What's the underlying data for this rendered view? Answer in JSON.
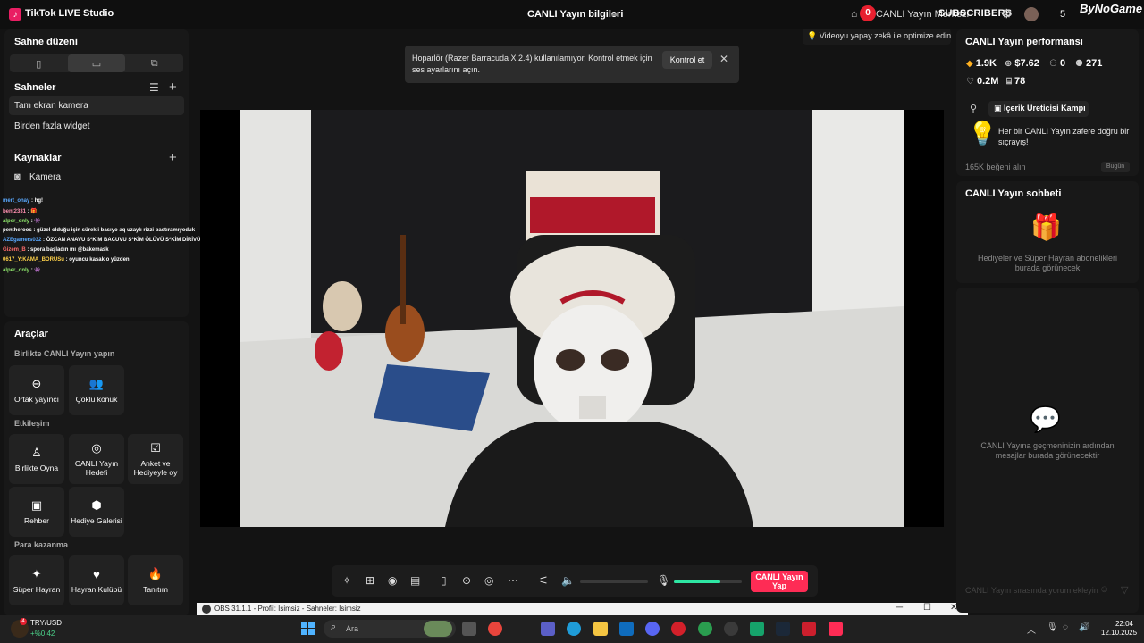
{
  "titlebar": {
    "app_title": "TikTok LIVE Studio",
    "center_title": "CANLI Yayın bilgileri",
    "notification_count": "0",
    "live_center_label": "CANLI Yayın Merkezi",
    "subscribers_label": "SUBSCRIBERS",
    "count_right": "5",
    "bynogame": "ByNoGame"
  },
  "left": {
    "layout_title": "Sahne düzeni",
    "scenes_title": "Sahneler",
    "scenes": [
      "Tam ekran kamera",
      "Birden fazla widget"
    ],
    "sources_title": "Kaynaklar",
    "sources": [
      "Kamera"
    ],
    "chat_overlay": [
      {
        "user": "mert_onay",
        "text": ": hg!",
        "color": "#5aa9ff"
      },
      {
        "user": "bent2331",
        "text": ": 🎁",
        "color": "#ff8fb0"
      },
      {
        "user": "alper_only",
        "text": ": 👾",
        "color": "#8de36a"
      },
      {
        "user": "pentheroos",
        "text": ": güzel olduğu için sürekli basıyo aq uzaylı rizzi bastıramıyoduk",
        "color": "#ffffff"
      },
      {
        "user": "AZEgamers032",
        "text": ": ÖZCAN ANAVU S*KİM BACUVU S*KİM ÖLÜVÜ S*KİM DİRİVÜ S*KİM",
        "color": "#5aa9ff"
      },
      {
        "user": "Gizem_B",
        "text": ": spora başladın mı @bakemask",
        "color": "#ff6b6b"
      },
      {
        "user": "0617_Y:KAMA_BORUSu",
        "text": ": oyuncu kasak o yüzden",
        "color": "#ffd24a"
      },
      {
        "user": "alper_only",
        "text": ": 👾",
        "color": "#8de36a"
      }
    ],
    "tools_title": "Araçlar",
    "section_together": "Birlikte CANLI Yayın yapın",
    "section_interaction": "Etkileşim",
    "section_earn": "Para kazanma",
    "tools": {
      "cohost": "Ortak yayıncı",
      "multi_guest": "Çoklu konuk",
      "play_together": "Birlikte Oyna",
      "live_goal": "CANLI Yayın Hedefi",
      "poll": "Anket ve Hediyeyle oy",
      "guide": "Rehber",
      "gift_gallery": "Hediye Galerisi",
      "super_fan": "Süper Hayran",
      "fan_club": "Hayran Kulübü",
      "promote": "Tanıtım"
    }
  },
  "toast": {
    "message": "Hoparlör (Razer Barracuda X 2.4) kullanılamıyor. Kontrol etmek için ses ayarlarını açın.",
    "button": "Kontrol et"
  },
  "optimize_label": "Videoyu yapay zekâ ile optimize edin",
  "controls": {
    "go_live": "CANLI Yayın Yap",
    "mic_level": 0.68
  },
  "obs": {
    "title": "OBS 31.1.1 - Profil: İsimsiz - Sahneler: İsimsiz"
  },
  "right": {
    "perf_title": "CANLI Yayın performansı",
    "stats": {
      "diamonds": "1.9K",
      "earnings": "$7.62",
      "new_followers": "0",
      "viewers": "271",
      "likes": "0.2M",
      "gifters": "78"
    },
    "campaign_button": "İçerik Üreticisi Kampı",
    "campaign_text": "Her bir CANLI Yayın zafere doğru bir sıçrayış!",
    "likes_received": "165K beğeni alın",
    "today": "Bugün",
    "chat_title": "CANLI Yayın sohbeti",
    "gifts_empty": "Hediyeler ve Süper Hayran abonelikleri burada görünecek",
    "messages_empty": "CANLI Yayına geçmeninizin ardından mesajlar burada görünecektir",
    "chat_placeholder": "CANLI Yayın sırasında yorum ekleyin"
  },
  "taskbar": {
    "currency_pair": "TRY/USD",
    "currency_change": "+%0,42",
    "search_placeholder": "Ara",
    "time": "22:04",
    "date": "12.10.2025",
    "weather_badge": "4"
  }
}
